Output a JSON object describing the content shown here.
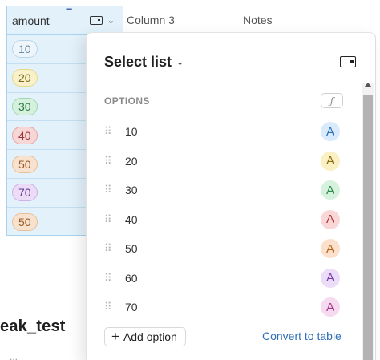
{
  "table": {
    "columns": [
      {
        "label": "amount"
      },
      {
        "label": "Column 3"
      },
      {
        "label": "Notes"
      }
    ],
    "amount_cells": [
      {
        "value": "10",
        "bg": "#eef6fc",
        "fg": "#6b8aa6",
        "border": "#b9d5ea"
      },
      {
        "value": "20",
        "bg": "#f8f1c9",
        "fg": "#7a6a1f",
        "border": "#e6d98a"
      },
      {
        "value": "30",
        "bg": "#d5f0dd",
        "fg": "#2c7a44",
        "border": "#9fd8b0"
      },
      {
        "value": "40",
        "bg": "#f7d6d6",
        "fg": "#9a3434",
        "border": "#e6a5a5"
      },
      {
        "value": "50",
        "bg": "#f7e2cf",
        "fg": "#9a5a21",
        "border": "#e9bf97"
      },
      {
        "value": "70",
        "bg": "#ecdcf7",
        "fg": "#6a3a93",
        "border": "#cfb0e8"
      },
      {
        "value": "50",
        "bg": "#f7e2cf",
        "fg": "#9a5a21",
        "border": "#e9bf97"
      }
    ],
    "partial_title": "eak_test",
    "partial_sub": "..."
  },
  "popover": {
    "title": "Select list",
    "options_label": "OPTIONS",
    "formula_icon": "ƒ",
    "options": [
      {
        "value": "10",
        "letter": "A",
        "bg": "#d9ebfb",
        "fg": "#2f6fb5"
      },
      {
        "value": "20",
        "letter": "A",
        "bg": "#faf0c4",
        "fg": "#8a6d10"
      },
      {
        "value": "30",
        "letter": "A",
        "bg": "#d6f2de",
        "fg": "#2c8a4a"
      },
      {
        "value": "40",
        "letter": "A",
        "bg": "#f9d7d7",
        "fg": "#b23a3a"
      },
      {
        "value": "50",
        "letter": "A",
        "bg": "#fbe1cb",
        "fg": "#b5651d"
      },
      {
        "value": "60",
        "letter": "A",
        "bg": "#ebdcf8",
        "fg": "#7a3fb0"
      },
      {
        "value": "70",
        "letter": "A",
        "bg": "#f6daf0",
        "fg": "#a63a8e"
      }
    ],
    "add_option_label": "Add option",
    "convert_label": "Convert to table"
  }
}
